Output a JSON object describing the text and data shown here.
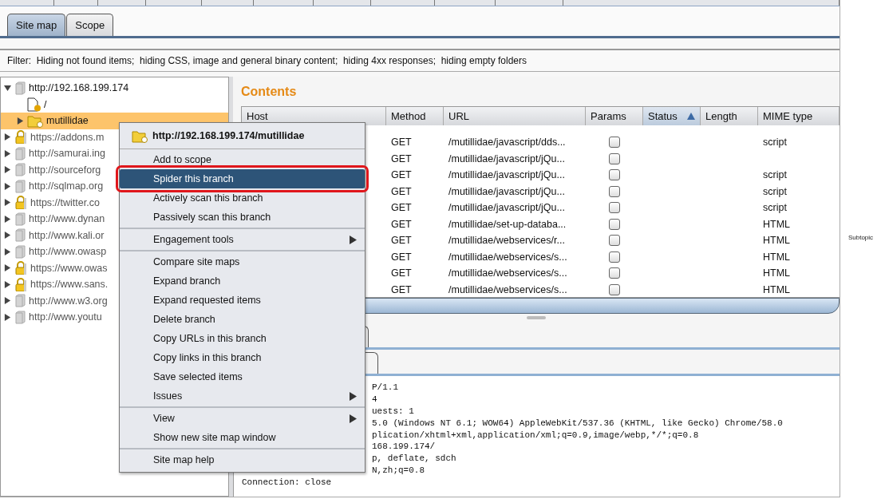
{
  "tabs": [
    {
      "label": "Site map",
      "selected": true
    },
    {
      "label": "Scope",
      "selected": false
    }
  ],
  "filter": "Filter:  Hiding not found items;  hiding CSS, image and general binary content;  hiding 4xx responses;  hiding empty folders",
  "tree": [
    {
      "label": "http://192.168.199.174",
      "kind": "host",
      "secure": false,
      "expanded": true,
      "selected": false,
      "children": [
        {
          "label": "/",
          "kind": "file",
          "selected": false
        },
        {
          "label": "mutillidae",
          "kind": "folder",
          "expanded": false,
          "selected": true
        }
      ]
    },
    {
      "label": "https://addons.m",
      "kind": "host",
      "secure": true,
      "expanded": false,
      "selected": false
    },
    {
      "label": "http://samurai.ing",
      "kind": "host",
      "secure": false,
      "expanded": false,
      "selected": false
    },
    {
      "label": "http://sourceforg",
      "kind": "host",
      "secure": false,
      "expanded": false,
      "selected": false
    },
    {
      "label": "http://sqlmap.org",
      "kind": "host",
      "secure": false,
      "expanded": false,
      "selected": false
    },
    {
      "label": "https://twitter.co",
      "kind": "host",
      "secure": true,
      "expanded": false,
      "selected": false
    },
    {
      "label": "http://www.dynan",
      "kind": "host",
      "secure": false,
      "expanded": false,
      "selected": false
    },
    {
      "label": "http://www.kali.or",
      "kind": "host",
      "secure": false,
      "expanded": false,
      "selected": false
    },
    {
      "label": "http://www.owasp",
      "kind": "host",
      "secure": false,
      "expanded": false,
      "selected": false
    },
    {
      "label": "https://www.owas",
      "kind": "host",
      "secure": true,
      "expanded": false,
      "selected": false
    },
    {
      "label": "https://www.sans.",
      "kind": "host",
      "secure": true,
      "expanded": false,
      "selected": false
    },
    {
      "label": "http://www.w3.org",
      "kind": "host",
      "secure": false,
      "expanded": false,
      "selected": false
    },
    {
      "label": "http://www.youtu",
      "kind": "host",
      "secure": false,
      "expanded": false,
      "selected": false
    }
  ],
  "contents": {
    "title": "Contents",
    "columns": [
      {
        "label": "Host",
        "sorted": false
      },
      {
        "label": "Method",
        "sorted": false
      },
      {
        "label": "URL",
        "sorted": false
      },
      {
        "label": "Params",
        "sorted": false
      },
      {
        "label": "Status",
        "sorted": true
      },
      {
        "label": "Length",
        "sorted": false
      },
      {
        "label": "MIME type",
        "sorted": false
      }
    ],
    "rows": [
      {
        "method": "GET",
        "url": "/mutillidae/javascript/dds...",
        "params": false,
        "mime": "script"
      },
      {
        "method": "GET",
        "url": "/mutillidae/javascript/jQu...",
        "params": false
      },
      {
        "method": "GET",
        "url": "/mutillidae/javascript/jQu...",
        "params": false,
        "mime": "script"
      },
      {
        "method": "GET",
        "url": "/mutillidae/javascript/jQu...",
        "params": false,
        "mime": "script"
      },
      {
        "method": "GET",
        "url": "/mutillidae/javascript/jQu...",
        "params": false,
        "mime": "script"
      },
      {
        "method": "GET",
        "url": "/mutillidae/set-up-databa...",
        "params": false,
        "mime": "HTML"
      },
      {
        "method": "GET",
        "url": "/mutillidae/webservices/r...",
        "params": false,
        "mime": "HTML"
      },
      {
        "method": "GET",
        "url": "/mutillidae/webservices/s...",
        "params": false,
        "mime": "HTML"
      },
      {
        "method": "GET",
        "url": "/mutillidae/webservices/s...",
        "params": false,
        "mime": "HTML"
      },
      {
        "method": "GET",
        "url": "/mutillidae/webservices/s...",
        "params": false,
        "mime": "HTML"
      }
    ]
  },
  "raw_request": [
    {
      "text": "P/1.1",
      "covered": true
    },
    {
      "text": "4",
      "covered": true
    },
    {
      "text": "uests: 1",
      "covered": true
    },
    {
      "text": "5.0 (Windows NT 6.1; WOW64) AppleWebKit/537.36 (KHTML, like Gecko) Chrome/58.0",
      "covered": true
    },
    {
      "text": "plication/xhtml+xml,application/xml;q=0.9,image/webp,*/*;q=0.8",
      "covered": true
    },
    {
      "text": "168.199.174/",
      "covered": true
    },
    {
      "text": "p, deflate, sdch",
      "covered": true
    },
    {
      "text": "N,zh;q=0.8",
      "covered": true
    },
    {
      "text": "Connection: close"
    }
  ],
  "context_menu": {
    "title": "http://192.168.199.174/mutillidae",
    "groups": [
      [
        {
          "label": "Add to scope",
          "submenu": false,
          "highlighted": false
        },
        {
          "label": "Spider this branch",
          "submenu": false,
          "highlighted": true
        },
        {
          "label": "Actively scan this branch",
          "submenu": false,
          "highlighted": false
        },
        {
          "label": "Passively scan this branch",
          "submenu": false,
          "highlighted": false
        }
      ],
      [
        {
          "label": "Engagement tools",
          "submenu": true,
          "highlighted": false
        }
      ],
      [
        {
          "label": "Compare site maps",
          "submenu": false,
          "highlighted": false
        },
        {
          "label": "Expand branch",
          "submenu": false,
          "highlighted": false
        },
        {
          "label": "Expand requested items",
          "submenu": false,
          "highlighted": false
        },
        {
          "label": "Delete branch",
          "submenu": false,
          "highlighted": false
        },
        {
          "label": "Copy URLs in this branch",
          "submenu": false,
          "highlighted": false
        },
        {
          "label": "Copy links in this branch",
          "submenu": false,
          "highlighted": false
        },
        {
          "label": "Save selected items",
          "submenu": false,
          "highlighted": false
        },
        {
          "label": "Issues",
          "submenu": true,
          "highlighted": false
        }
      ],
      [
        {
          "label": "View",
          "submenu": true,
          "highlighted": false
        },
        {
          "label": "Show new site map window",
          "submenu": false,
          "highlighted": false
        }
      ],
      [
        {
          "label": "Site map help",
          "submenu": false,
          "highlighted": false
        }
      ]
    ]
  },
  "side_note": "Subtopic"
}
